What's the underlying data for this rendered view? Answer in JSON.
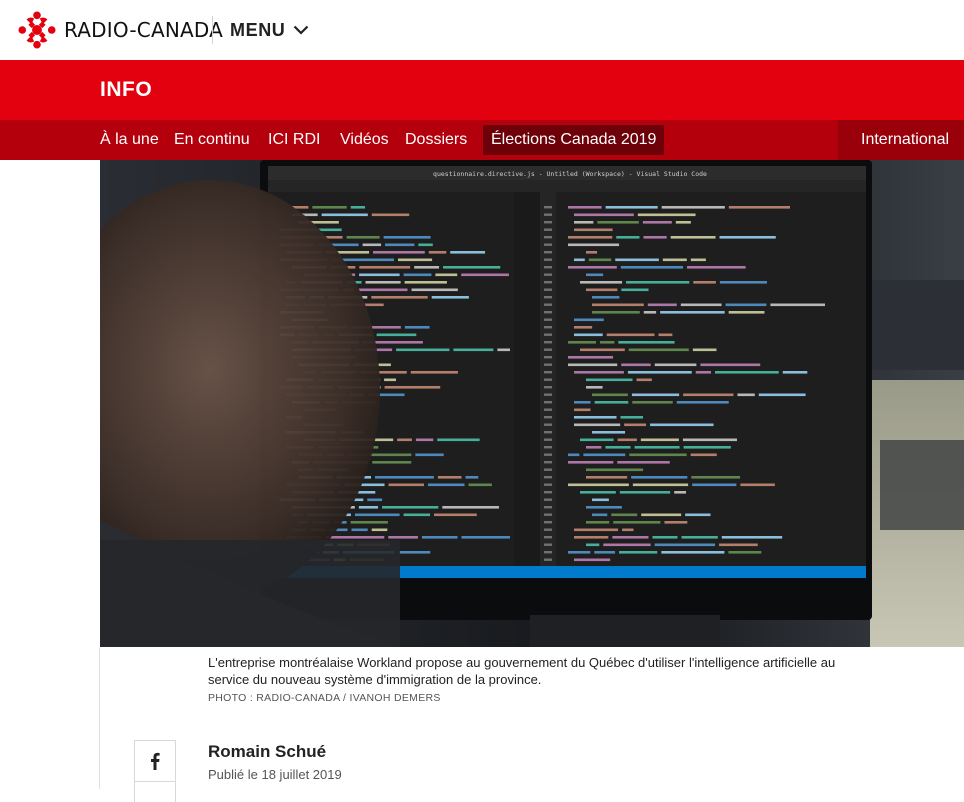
{
  "header": {
    "brand": "RADIO-CANADA",
    "menu_label": "MENU"
  },
  "section": {
    "title": "INFO"
  },
  "nav": {
    "items": [
      {
        "label": "À la une"
      },
      {
        "label": "En continu"
      },
      {
        "label": "ICI RDI"
      },
      {
        "label": "Vidéos"
      },
      {
        "label": "Dossiers"
      },
      {
        "label": "Élections Canada 2019"
      },
      {
        "label": "International"
      }
    ],
    "active_index": 5
  },
  "photo": {
    "window_title": "questionnaire.directive.js - Untitled (Workspace) - Visual Studio Code",
    "caption": "L'entreprise montréalaise Workland propose au gouvernement du Québec d'utiliser l'intelligence artificielle au service du nouveau système d'immigration de la province.",
    "credit": "PHOTO : RADIO-CANADA / IVANOH DEMERS"
  },
  "article": {
    "author": "Romain Schué",
    "published": "Publié le 18 juillet 2019"
  },
  "colors": {
    "brand_red": "#e3000f",
    "nav_red": "#b3000c",
    "active_tab": "#6d0008"
  }
}
